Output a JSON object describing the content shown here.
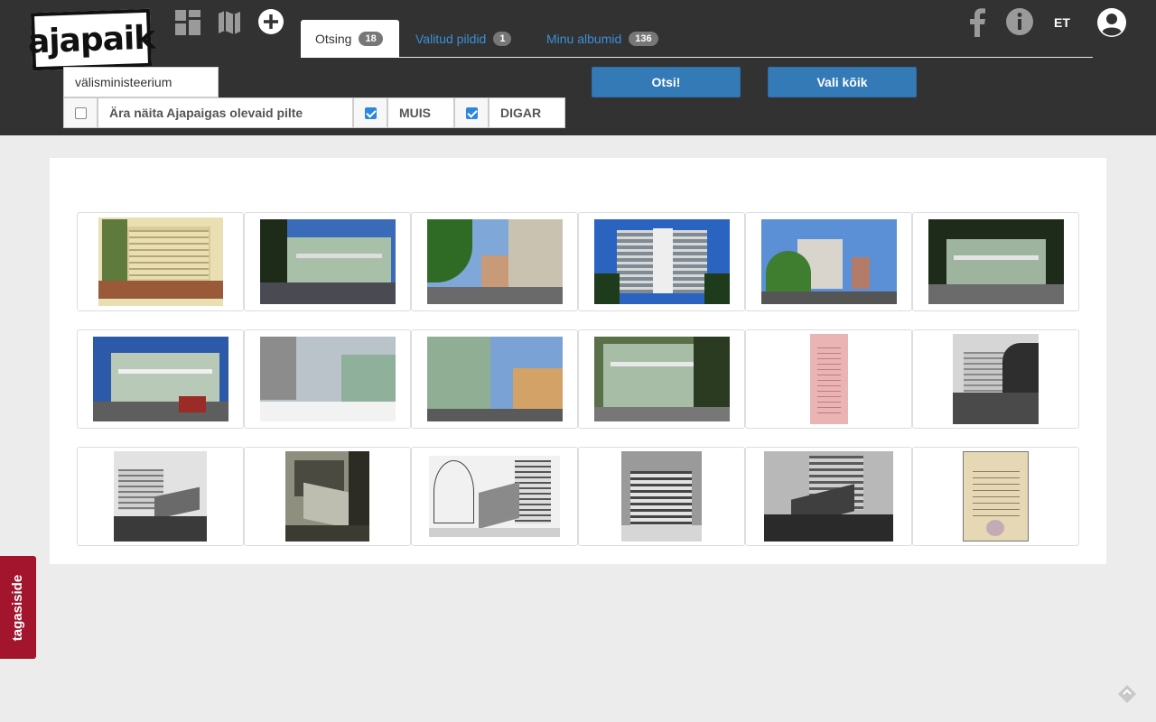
{
  "header": {
    "logo_text": "ajapaik",
    "icons": [
      "grid-icon",
      "map-icon",
      "plus-circle-icon",
      "facebook-icon",
      "info-icon",
      "user-icon"
    ],
    "language": "ET",
    "tabs": [
      {
        "label": "Otsing",
        "count": "18",
        "active": true
      },
      {
        "label": "Valitud pildid",
        "count": "1",
        "active": false
      },
      {
        "label": "Minu albumid",
        "count": "136",
        "active": false
      }
    ]
  },
  "search": {
    "value": "välisministeerium",
    "submit_label": "Otsi!",
    "select_all_label": "Vali kõik"
  },
  "filters": [
    {
      "label": "Ära näita Ajapaigas olevaid pilte",
      "checked": false
    },
    {
      "label": "MUIS",
      "checked": true
    },
    {
      "label": "DIGAR",
      "checked": true
    }
  ],
  "results": {
    "count": 18,
    "colors": {
      "bw": "#888888",
      "color": "#6b8f5e",
      "document": "#e8d9b0"
    }
  },
  "feedback_label": "tagasiside",
  "colors": {
    "header_bg": "#323232",
    "primary": "#337ab7",
    "link": "#3b8fd8",
    "feedback": "#a3152d"
  }
}
